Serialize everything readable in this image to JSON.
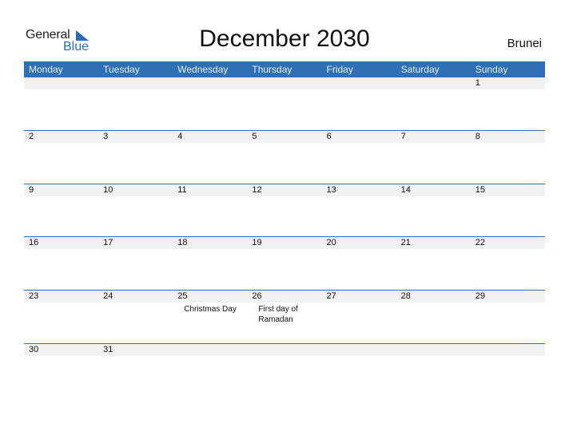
{
  "logo": {
    "general": "General",
    "blue": "Blue"
  },
  "title": "December 2030",
  "country": "Brunei",
  "days": [
    "Monday",
    "Tuesday",
    "Wednesday",
    "Thursday",
    "Friday",
    "Saturday",
    "Sunday"
  ],
  "weeks": [
    [
      {
        "day": ""
      },
      {
        "day": ""
      },
      {
        "day": ""
      },
      {
        "day": ""
      },
      {
        "day": ""
      },
      {
        "day": ""
      },
      {
        "day": "1"
      }
    ],
    [
      {
        "day": "2"
      },
      {
        "day": "3"
      },
      {
        "day": "4"
      },
      {
        "day": "5"
      },
      {
        "day": "6"
      },
      {
        "day": "7"
      },
      {
        "day": "8"
      }
    ],
    [
      {
        "day": "9"
      },
      {
        "day": "10"
      },
      {
        "day": "11"
      },
      {
        "day": "12"
      },
      {
        "day": "13"
      },
      {
        "day": "14"
      },
      {
        "day": "15"
      }
    ],
    [
      {
        "day": "16"
      },
      {
        "day": "17"
      },
      {
        "day": "18"
      },
      {
        "day": "19"
      },
      {
        "day": "20"
      },
      {
        "day": "21"
      },
      {
        "day": "22"
      }
    ],
    [
      {
        "day": "23"
      },
      {
        "day": "24"
      },
      {
        "day": "25",
        "event": "Christmas Day"
      },
      {
        "day": "26",
        "event": "First day of Ramadan"
      },
      {
        "day": "27"
      },
      {
        "day": "28"
      },
      {
        "day": "29"
      }
    ],
    [
      {
        "day": "30"
      },
      {
        "day": "31"
      },
      {
        "day": ""
      },
      {
        "day": ""
      },
      {
        "day": ""
      },
      {
        "day": ""
      },
      {
        "day": ""
      }
    ]
  ],
  "colors": {
    "accent": "#2e70b3",
    "day_strip": "#f1f1f1"
  }
}
